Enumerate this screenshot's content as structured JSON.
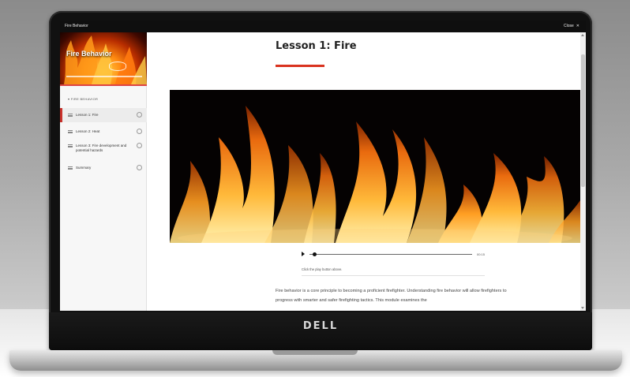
{
  "window": {
    "course_title": "Fire Behavior",
    "close_label": "Close"
  },
  "sidebar": {
    "hero_title": "Fire Behavior",
    "section_label": "FIRE BEHAVIOR",
    "items": [
      {
        "label": "Lesson 1: Fire",
        "active": true
      },
      {
        "label": "Lesson 2: Heat",
        "active": false
      },
      {
        "label": "Lesson 3: Fire development and potential hazards",
        "active": false
      },
      {
        "label": "Summary",
        "active": false
      }
    ]
  },
  "lesson": {
    "title": "Lesson 1: Fire",
    "media_caption": "Click the play button above.",
    "time": "00:15",
    "body": "Fire behavior is a core principle to becoming a proficient firefighter. Understanding fire behavior will allow firefighters to progress with smarter and safer firefighting tactics. This module examines the"
  },
  "device": {
    "brand": "DELL"
  },
  "colors": {
    "accent": "#d9331f",
    "topbar": "#0f0f0f",
    "sidebar_bg": "#f7f7f7"
  }
}
